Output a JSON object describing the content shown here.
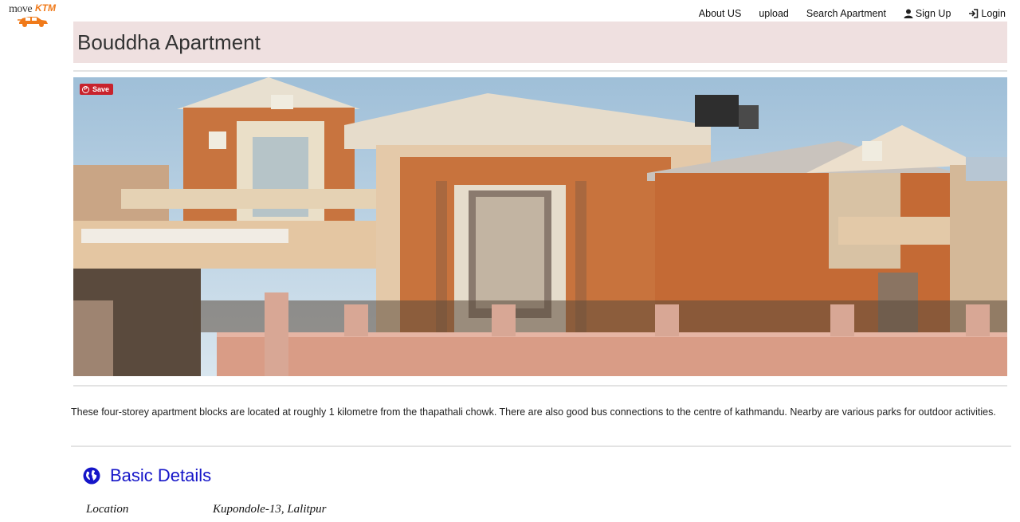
{
  "logo": {
    "text_left": "move",
    "text_right": "KTM",
    "icon": "car-icon"
  },
  "nav": {
    "items": [
      {
        "label": "About US",
        "icon": ""
      },
      {
        "label": "upload",
        "icon": ""
      },
      {
        "label": "Search Apartment",
        "icon": ""
      },
      {
        "label": "Sign Up",
        "icon": "user-icon"
      },
      {
        "label": "Login",
        "icon": "login-icon"
      }
    ]
  },
  "title": "Bouddha Apartment",
  "photo": {
    "save_label": "Save",
    "description": "brick apartment building photo"
  },
  "description": "These four-storey apartment blocks are located at roughly 1 kilometre from the thapathali chowk. There are also good bus connections to the centre of kathmandu. Nearby are various parks for outdoor activities.",
  "basic_details": {
    "heading": "Basic Details",
    "icon": "globe-icon",
    "rows": [
      {
        "label": "Location",
        "value": "Kupondole-13, Lalitpur"
      }
    ]
  },
  "colors": {
    "title_bg": "#efe0e0",
    "heading_blue": "#1515c8",
    "save_red": "#c8232c",
    "logo_orange": "#f07a1a"
  }
}
